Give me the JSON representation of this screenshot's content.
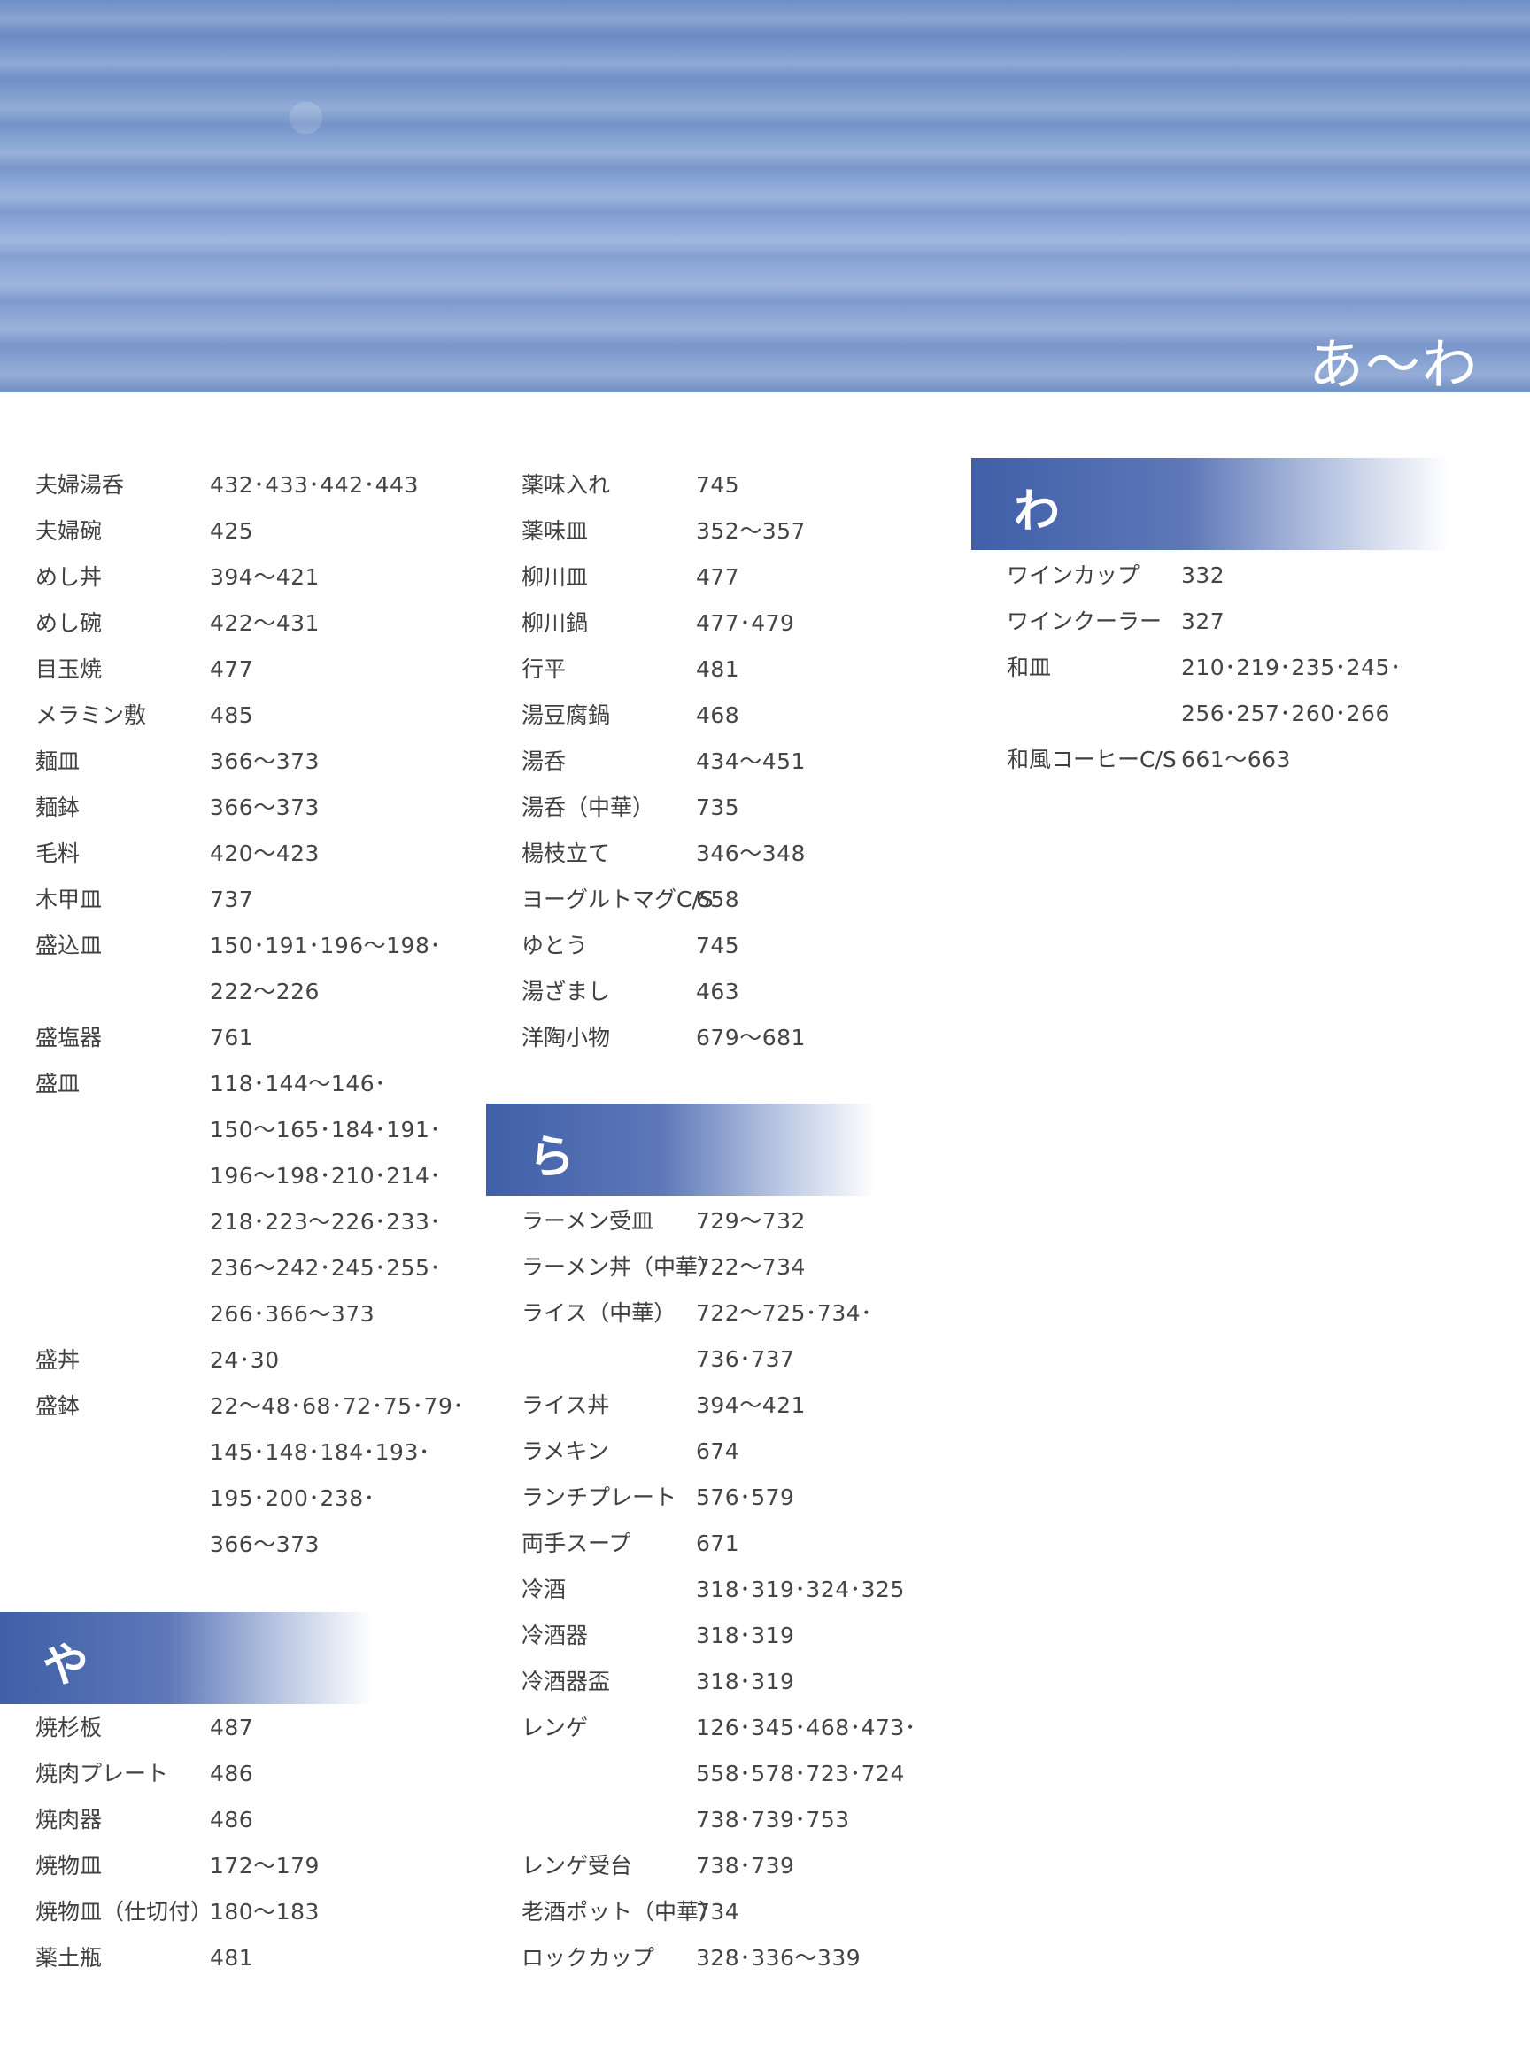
{
  "banner_title": "あ〜わ",
  "column1": {
    "entries": [
      {
        "label": "夫婦湯呑",
        "value": "432･433･442･443"
      },
      {
        "label": "夫婦碗",
        "value": "425"
      },
      {
        "label": "めし丼",
        "value": "394〜421"
      },
      {
        "label": "めし碗",
        "value": "422〜431"
      },
      {
        "label": "目玉焼",
        "value": "477"
      },
      {
        "label": "メラミン敷",
        "value": "485"
      },
      {
        "label": "麺皿",
        "value": "366〜373"
      },
      {
        "label": "麺鉢",
        "value": "366〜373"
      },
      {
        "label": "毛料",
        "value": "420〜423"
      },
      {
        "label": "木甲皿",
        "value": "737"
      },
      {
        "label": "盛込皿",
        "value": "150･191･196〜198･"
      },
      {
        "label": "",
        "value": "222〜226"
      },
      {
        "label": "盛塩器",
        "value": "761"
      },
      {
        "label": "盛皿",
        "value": "118･144〜146･"
      },
      {
        "label": "",
        "value": "150〜165･184･191･"
      },
      {
        "label": "",
        "value": "196〜198･210･214･"
      },
      {
        "label": "",
        "value": "218･223〜226･233･"
      },
      {
        "label": "",
        "value": "236〜242･245･255･"
      },
      {
        "label": "",
        "value": "266･366〜373"
      },
      {
        "label": "盛丼",
        "value": "24･30"
      },
      {
        "label": "盛鉢",
        "value": "22〜48･68･72･75･79･"
      },
      {
        "label": "",
        "value": "145･148･184･193･"
      },
      {
        "label": "",
        "value": "195･200･238･"
      },
      {
        "label": "",
        "value": "366〜373"
      }
    ],
    "ya_header": "や",
    "ya_entries": [
      {
        "label": "焼杉板",
        "value": "487"
      },
      {
        "label": "焼肉プレート",
        "value": "486"
      },
      {
        "label": "焼肉器",
        "value": "486"
      },
      {
        "label": "焼物皿",
        "value": "172〜179"
      },
      {
        "label": "焼物皿（仕切付）",
        "value": "180〜183"
      },
      {
        "label": "薬土瓶",
        "value": "481"
      }
    ]
  },
  "column2": {
    "entries": [
      {
        "label": "薬味入れ",
        "value": "745"
      },
      {
        "label": "薬味皿",
        "value": "352〜357"
      },
      {
        "label": "柳川皿",
        "value": "477"
      },
      {
        "label": "柳川鍋",
        "value": "477･479"
      },
      {
        "label": "行平",
        "value": "481"
      },
      {
        "label": "湯豆腐鍋",
        "value": "468"
      },
      {
        "label": "湯呑",
        "value": "434〜451"
      },
      {
        "label": "湯呑（中華）",
        "value": "735"
      },
      {
        "label": "楊枝立て",
        "value": "346〜348"
      },
      {
        "label": "ヨーグルトマグC/S",
        "value": "658"
      },
      {
        "label": "ゆとう",
        "value": "745"
      },
      {
        "label": "湯ざまし",
        "value": "463"
      },
      {
        "label": "洋陶小物",
        "value": "679〜681"
      }
    ],
    "ra_header": "ら",
    "ra_entries": [
      {
        "label": "ラーメン受皿",
        "value": "729〜732"
      },
      {
        "label": "ラーメン丼（中華）",
        "value": "722〜734"
      },
      {
        "label": "ライス（中華）",
        "value": "722〜725･734･"
      },
      {
        "label": "",
        "value": "736･737"
      },
      {
        "label": "ライス丼",
        "value": "394〜421"
      },
      {
        "label": "ラメキン",
        "value": "674"
      },
      {
        "label": "ランチプレート",
        "value": "576･579"
      },
      {
        "label": "両手スープ",
        "value": "671"
      },
      {
        "label": "冷酒",
        "value": "318･319･324･325"
      },
      {
        "label": "冷酒器",
        "value": "318･319"
      },
      {
        "label": "冷酒器盃",
        "value": "318･319"
      },
      {
        "label": "レンゲ",
        "value": "126･345･468･473･"
      },
      {
        "label": "",
        "value": "558･578･723･724"
      },
      {
        "label": "",
        "value": "738･739･753"
      },
      {
        "label": "レンゲ受台",
        "value": "738･739"
      },
      {
        "label": "老酒ポット（中華）",
        "value": "734"
      },
      {
        "label": "ロックカップ",
        "value": "328･336〜339"
      }
    ]
  },
  "column3": {
    "wa_header": "わ",
    "wa_entries": [
      {
        "label": "ワインカップ",
        "value": "332"
      },
      {
        "label": "ワインクーラー",
        "value": "327"
      },
      {
        "label": "和皿",
        "value": "210･219･235･245･"
      },
      {
        "label": "",
        "value": "256･257･260･266"
      },
      {
        "label": "和風コーヒーC/S",
        "value": "661〜663"
      }
    ]
  }
}
